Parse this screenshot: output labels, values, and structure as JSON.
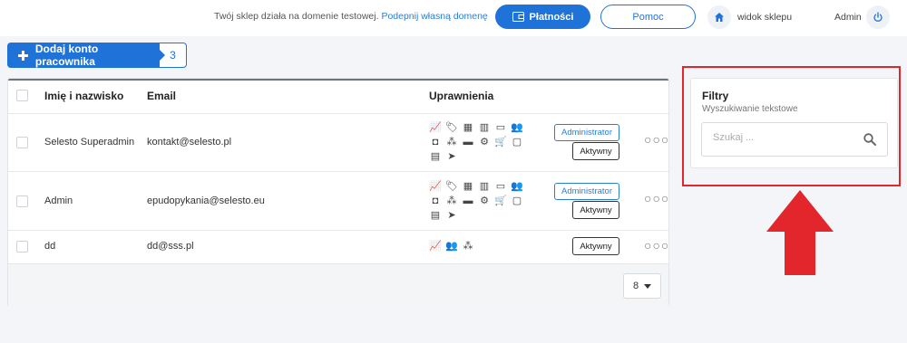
{
  "topbar": {
    "notice_text": "Twój sklep działa na domenie testowej.",
    "notice_link": "Podepnij własną domenę",
    "payments_label": "Płatności",
    "help_label": "Pomoc",
    "shop_view_label": "widok sklepu",
    "admin_label": "Admin"
  },
  "toolbar": {
    "add_employee_label": "Dodaj konto pracownika",
    "employee_count": "3"
  },
  "table": {
    "headers": {
      "name": "Imię i nazwisko",
      "email": "Email",
      "permissions": "Uprawnienia"
    },
    "rows": [
      {
        "name": "Selesto Superadmin",
        "email": "kontakt@selesto.pl",
        "role": "Administrator",
        "status": "Aktywny"
      },
      {
        "name": "Admin",
        "email": "epudopykania@selesto.eu",
        "role": "Administrator",
        "status": "Aktywny"
      },
      {
        "name": "dd",
        "email": "dd@sss.pl",
        "role": "",
        "status": "Aktywny"
      }
    ],
    "per_page": "8"
  },
  "filters": {
    "title": "Filtry",
    "subtitle": "Wyszukiwanie tekstowe",
    "search_placeholder": "Szukaj ..."
  },
  "colors": {
    "primary": "#1f73d8",
    "highlight": "#e3262b"
  }
}
